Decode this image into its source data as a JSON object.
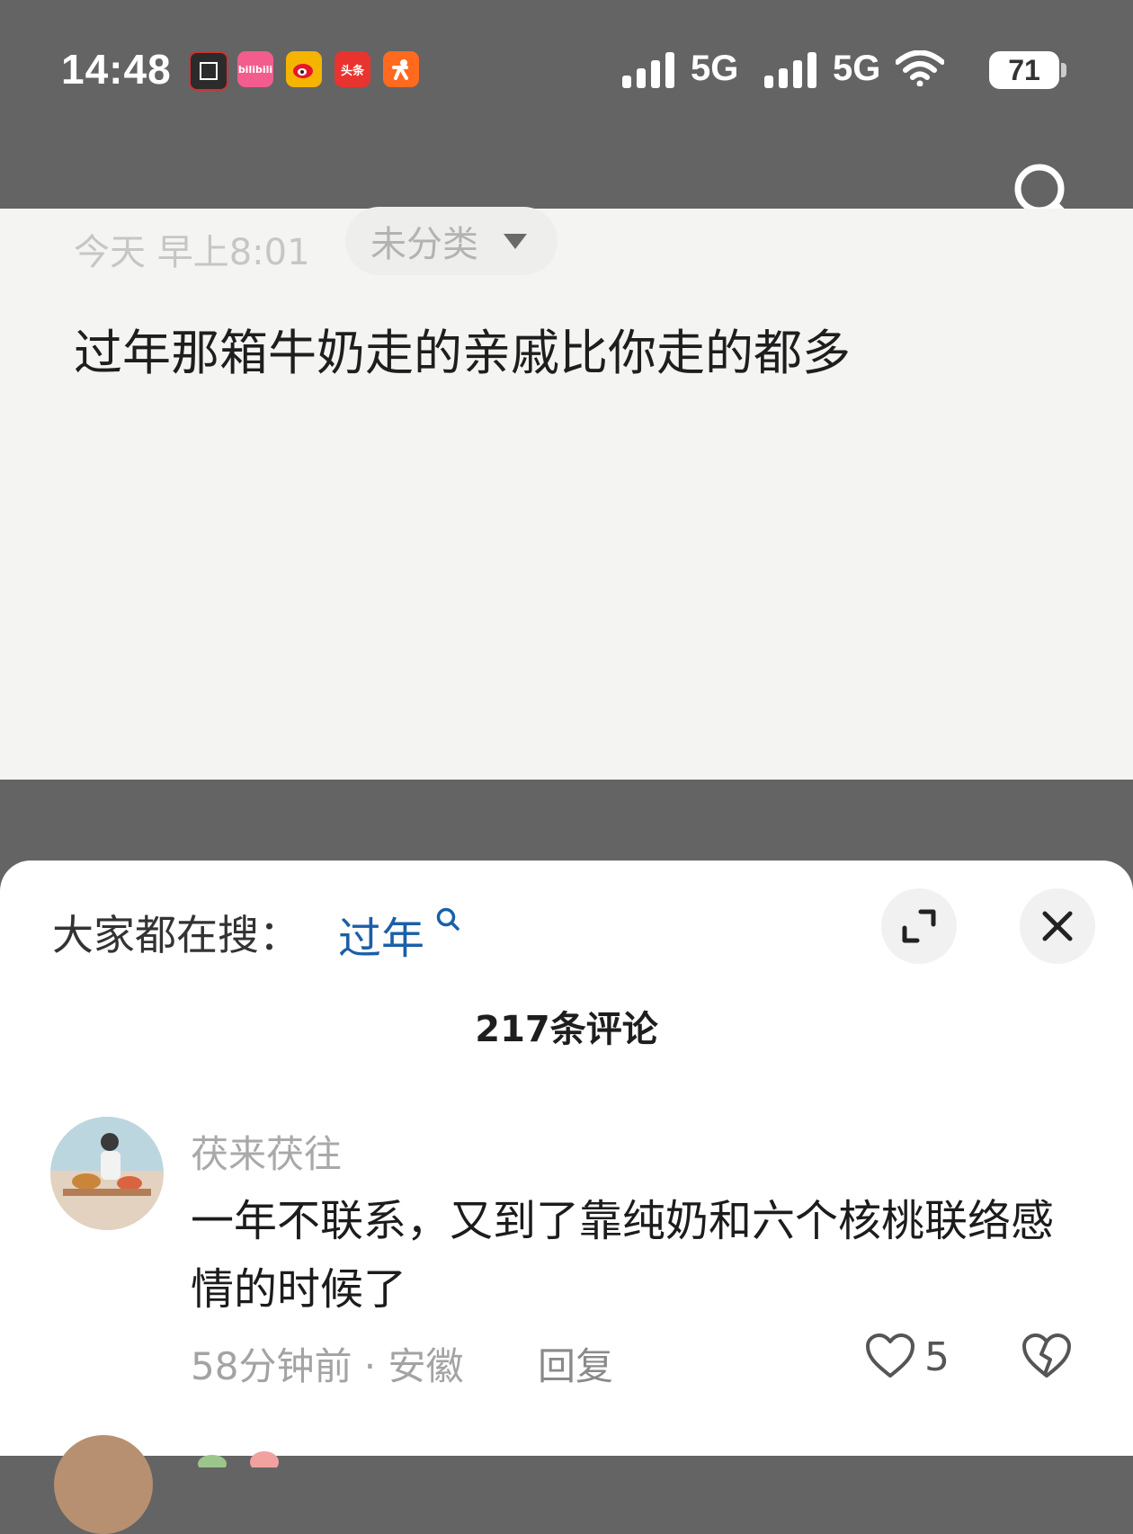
{
  "status_bar": {
    "time": "14:48",
    "app_icons": [
      {
        "name": "app-icon-1",
        "label": "",
        "color": "#2b2b2b"
      },
      {
        "name": "bilibili-icon",
        "label": "bilibili",
        "color": "#f25d8e"
      },
      {
        "name": "weibo-icon",
        "label": "",
        "color": "#f5b400"
      },
      {
        "name": "toutiao-icon",
        "label": "头条",
        "color": "#e8332f"
      },
      {
        "name": "app-icon-5",
        "label": "",
        "color": "#ff6a1f"
      }
    ],
    "network_1": "5G",
    "network_2": "5G",
    "battery": "71"
  },
  "note": {
    "date": "今天 早上8:01",
    "category": "未分类",
    "content": "过年那箱牛奶走的亲戚比你走的都多"
  },
  "sheet": {
    "hot_search_label": "大家都在搜：",
    "hot_search_keyword": "过年",
    "comment_count": "217条评论"
  },
  "comments": [
    {
      "user": "茯来茯往",
      "text": "一年不联系，又到了靠纯奶和六个核桃联络感情的时候了",
      "meta": "58分钟前 · 安徽",
      "reply": "回复",
      "likes": "5"
    }
  ],
  "colors": {
    "keyword": "#1a5fa8",
    "background_dim": "#646464",
    "note_bg": "#f4f4f3"
  }
}
